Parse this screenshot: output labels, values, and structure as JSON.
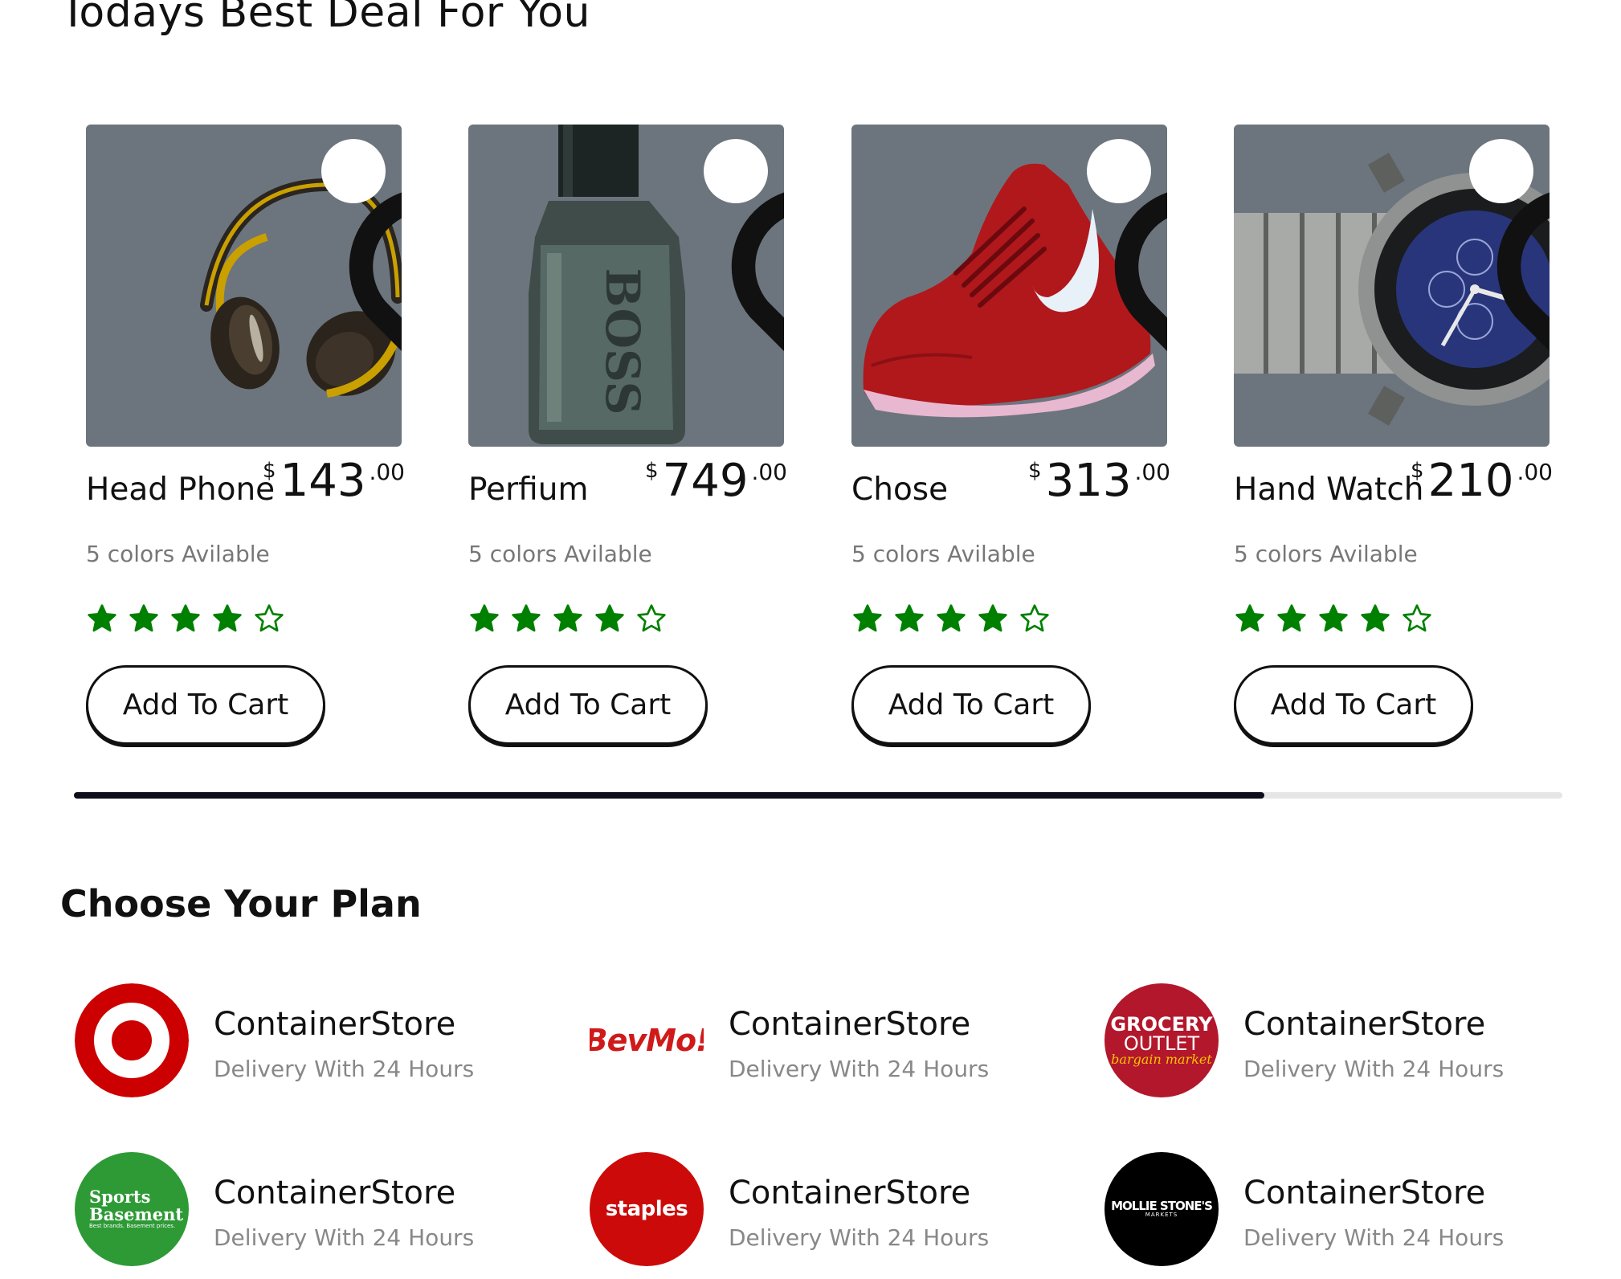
{
  "section_title": "Todays Best Deal For You",
  "products": [
    {
      "name": "Head Phone",
      "currency": "$",
      "price": "143",
      "cents": ".00",
      "colors": "5 colors Avilable",
      "rating": 4,
      "max_rating": 5,
      "button": "Add To Cart",
      "favorite_icon": "heart-outline-icon",
      "image": "headphones"
    },
    {
      "name": "Perfium",
      "currency": "$",
      "price": "749",
      "cents": ".00",
      "colors": "5 colors Avilable",
      "rating": 4,
      "max_rating": 5,
      "button": "Add To Cart",
      "favorite_icon": "heart-outline-icon",
      "image": "perfume-bottle"
    },
    {
      "name": "Chose",
      "currency": "$",
      "price": "313",
      "cents": ".00",
      "colors": "5 colors Avilable",
      "rating": 4,
      "max_rating": 5,
      "button": "Add To Cart",
      "favorite_icon": "heart-outline-icon",
      "image": "red-sneaker"
    },
    {
      "name": "Hand Watch",
      "currency": "$",
      "price": "210",
      "cents": ".00",
      "colors": "5 colors Avilable",
      "rating": 4,
      "max_rating": 5,
      "button": "Add To Cart",
      "favorite_icon": "heart-outline-icon",
      "image": "wrist-watch"
    }
  ],
  "carousel_scroll_fraction": 0.8,
  "plan_title": "Choose Your Plan",
  "stores": [
    {
      "logo": "Target",
      "name": "ContainerStore",
      "subtitle": "Delivery With 24 Hours"
    },
    {
      "logo": "BevMo!",
      "name": "ContainerStore",
      "subtitle": "Delivery With 24 Hours"
    },
    {
      "logo": "Grocery Outlet bargain market",
      "name": "ContainerStore",
      "subtitle": "Delivery With 24 Hours"
    },
    {
      "logo": "Sports Basement",
      "name": "ContainerStore",
      "subtitle": "Delivery With 24 Hours"
    },
    {
      "logo": "staples",
      "name": "ContainerStore",
      "subtitle": "Delivery With 24 Hours"
    },
    {
      "logo": "Mollie Stone's Markets",
      "name": "ContainerStore",
      "subtitle": "Delivery With 24 Hours"
    }
  ],
  "colors": {
    "card_background": "#6c757d",
    "star": "#008000",
    "scrollbar": "#0d0f1a",
    "subtitle_gray": "#888888"
  }
}
